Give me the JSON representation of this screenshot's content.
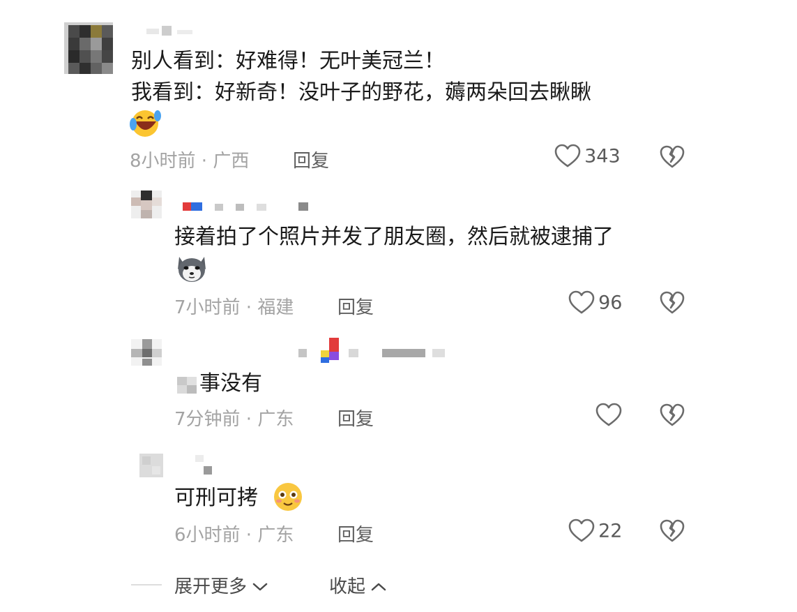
{
  "comments": [
    {
      "lines": [
        "别人看到：好难得！无叶美冠兰！",
        "我看到：好新奇！没叶子的野花，薅两朵回去瞅瞅"
      ],
      "emoji": "laughing-crying-emoji",
      "meta": "8小时前 · 广西",
      "reply_label": "回复",
      "likes": "343"
    },
    {
      "lines": [
        "接着拍了个照片并发了朋友圈，然后就被逮捕了"
      ],
      "emoji": "husky-dog-emoji",
      "meta": "7小时前 · 福建",
      "reply_label": "回复",
      "likes": "96"
    },
    {
      "lines": [
        "事没有"
      ],
      "meta": "7分钟前 · 广东",
      "reply_label": "回复",
      "likes": ""
    },
    {
      "lines": [
        "可刑可拷"
      ],
      "emoji": "smiling-blush-emoji",
      "meta": "6小时前 · 广东",
      "reply_label": "回复",
      "likes": "22"
    }
  ],
  "footer": {
    "expand_label": "展开更多",
    "collapse_label": "收起"
  },
  "colors": {
    "text": "#1a1a1a",
    "meta": "#a3a3a3",
    "reply": "#5f5f5f",
    "icon": "#6b6b6b"
  }
}
